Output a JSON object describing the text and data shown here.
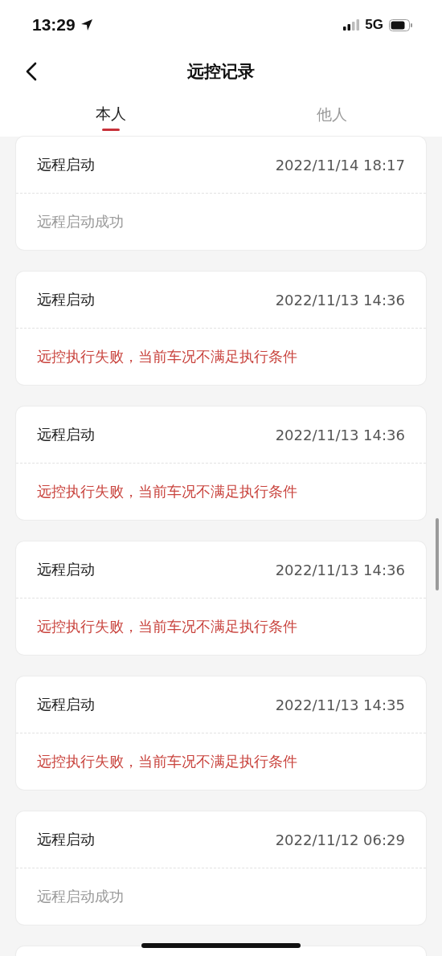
{
  "status_bar": {
    "time": "13:29",
    "network": "5G"
  },
  "header": {
    "title": "远控记录"
  },
  "tabs": [
    {
      "label": "本人",
      "selected": true
    },
    {
      "label": "他人",
      "selected": false
    }
  ],
  "records": [
    {
      "title": "远程启动",
      "time": "2022/11/14 18:17",
      "result": "远程启动成功",
      "kind": "success"
    },
    {
      "title": "远程启动",
      "time": "2022/11/13 14:36",
      "result": "远控执行失败，当前车况不满足执行条件",
      "kind": "failure"
    },
    {
      "title": "远程启动",
      "time": "2022/11/13 14:36",
      "result": "远控执行失败，当前车况不满足执行条件",
      "kind": "failure"
    },
    {
      "title": "远程启动",
      "time": "2022/11/13 14:36",
      "result": "远控执行失败，当前车况不满足执行条件",
      "kind": "failure"
    },
    {
      "title": "远程启动",
      "time": "2022/11/13 14:35",
      "result": "远控执行失败，当前车况不满足执行条件",
      "kind": "failure"
    },
    {
      "title": "远程启动",
      "time": "2022/11/12 06:29",
      "result": "远程启动成功",
      "kind": "success"
    }
  ]
}
